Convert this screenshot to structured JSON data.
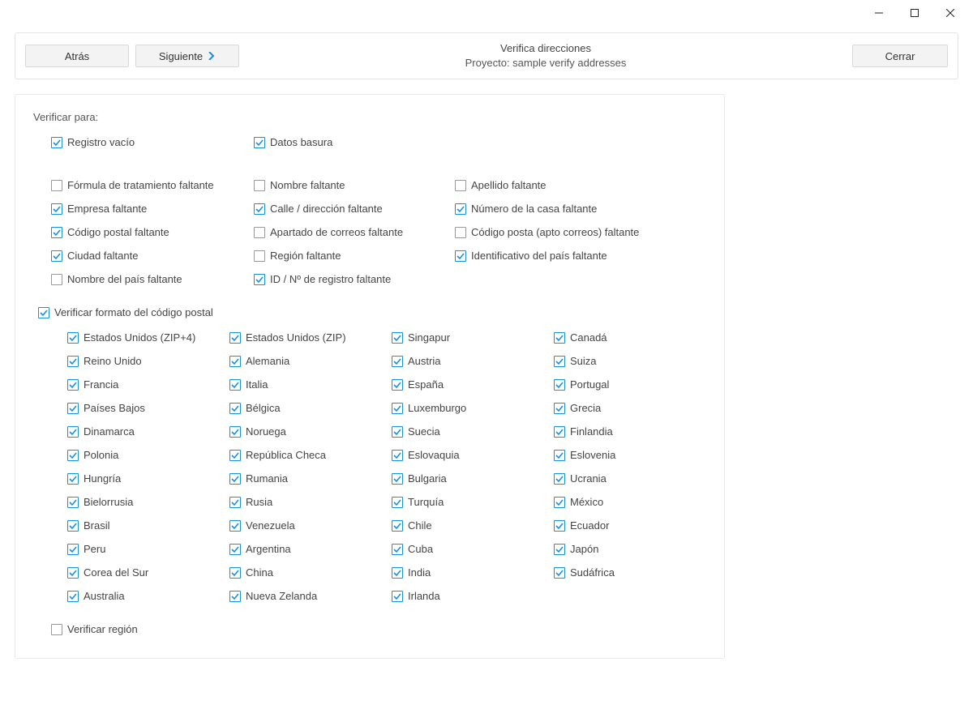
{
  "window": {
    "title": ""
  },
  "header": {
    "back_label": "Atrás",
    "next_label": "Siguiente",
    "close_label": "Cerrar",
    "title": "Verifica direcciones",
    "subtitle": "Proyecto: sample verify addresses"
  },
  "section": {
    "verify_for": "Verificar para:",
    "verify_zip_format": "Verificar formato del código postal",
    "verify_region": "Verificar región"
  },
  "checks": {
    "empty_record": {
      "label": "Registro vacío",
      "checked": true
    },
    "junk_data": {
      "label": "Datos basura",
      "checked": true
    },
    "salutation": {
      "label": "Fórmula de tratamiento faltante",
      "checked": false
    },
    "firstname": {
      "label": "Nombre faltante",
      "checked": false
    },
    "lastname": {
      "label": "Apellido faltante",
      "checked": false
    },
    "company": {
      "label": "Empresa faltante",
      "checked": true
    },
    "street": {
      "label": "Calle / dirección faltante",
      "checked": true
    },
    "house_no": {
      "label": "Número de la casa faltante",
      "checked": true
    },
    "zip": {
      "label": "Código postal faltante",
      "checked": true
    },
    "pobox": {
      "label": "Apartado de correos faltante",
      "checked": false
    },
    "pobox_zip": {
      "label": "Código posta (apto correos) faltante",
      "checked": false
    },
    "city": {
      "label": "Ciudad faltante",
      "checked": true
    },
    "region": {
      "label": "Región faltante",
      "checked": false
    },
    "country_id": {
      "label": "Identificativo del país faltante",
      "checked": true
    },
    "country_name": {
      "label": "Nombre del país faltante",
      "checked": false
    },
    "record_id": {
      "label": "ID / Nº de registro faltante",
      "checked": true
    }
  },
  "verify_zip_checked": true,
  "verify_region_checked": false,
  "countries": [
    [
      "Estados Unidos (ZIP+4)",
      "Estados Unidos (ZIP)",
      "Singapur",
      "Canadá"
    ],
    [
      "Reino Unido",
      "Alemania",
      "Austria",
      "Suiza"
    ],
    [
      "Francia",
      "Italia",
      "España",
      "Portugal"
    ],
    [
      "Países Bajos",
      "Bélgica",
      "Luxemburgo",
      "Grecia"
    ],
    [
      "Dinamarca",
      "Noruega",
      "Suecia",
      "Finlandia"
    ],
    [
      "Polonia",
      "República Checa",
      "Eslovaquia",
      "Eslovenia"
    ],
    [
      "Hungría",
      "Rumania",
      "Bulgaria",
      "Ucrania"
    ],
    [
      "Bielorrusia",
      "Rusia",
      "Turquía",
      "México"
    ],
    [
      "Brasil",
      "Venezuela",
      "Chile",
      "Ecuador"
    ],
    [
      "Peru",
      "Argentina",
      "Cuba",
      "Japón"
    ],
    [
      "Corea del Sur",
      "China",
      "India",
      "Sudáfrica"
    ],
    [
      "Australia",
      "Nueva Zelanda",
      "Irlanda",
      ""
    ]
  ]
}
